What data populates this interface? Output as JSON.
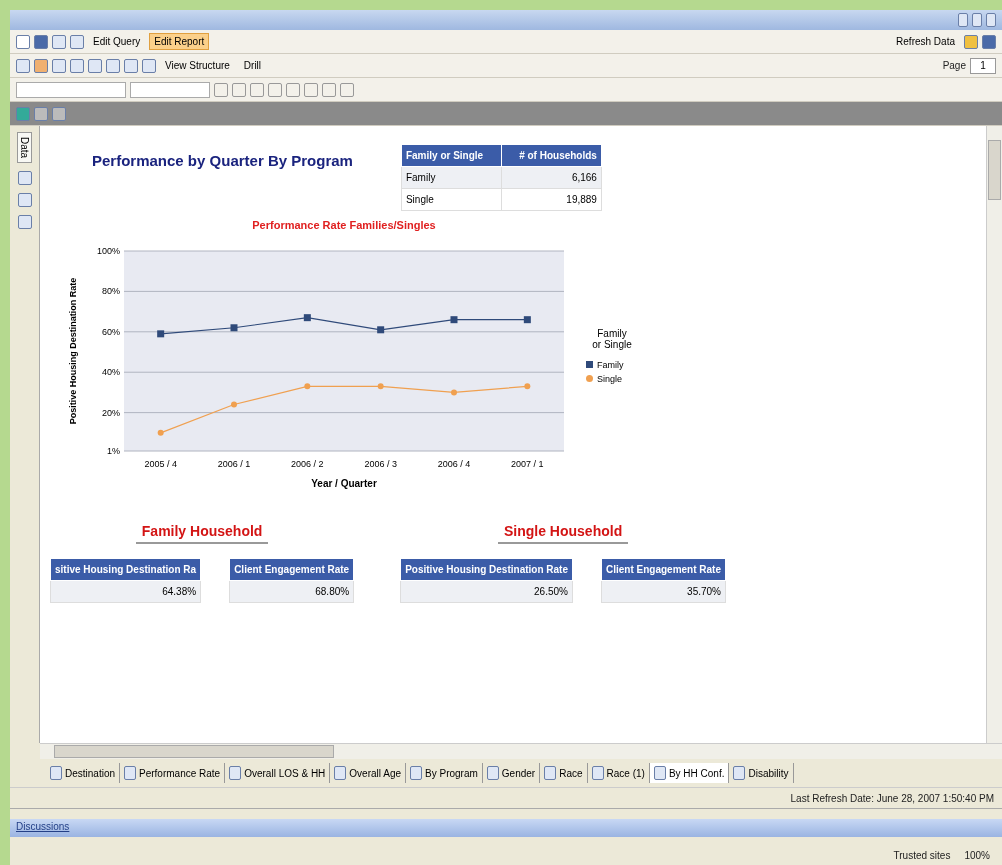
{
  "toolbar": {
    "edit_buttons": [
      {
        "label": "Edit Query",
        "selected": false
      },
      {
        "label": "Edit Report",
        "selected": true
      }
    ],
    "refresh": "Refresh Data"
  },
  "toolbar2": {
    "view_structure": "View Structure",
    "drill": "Drill",
    "page_label": "Page",
    "page_value": "1"
  },
  "side_tab": "Data",
  "report": {
    "title": "Performance by Quarter By Program",
    "summary_table": {
      "columns": [
        "Family or Single",
        "# of Households"
      ],
      "rows": [
        [
          "Family",
          "6,166"
        ],
        [
          "Single",
          "19,889"
        ]
      ]
    },
    "chart": {
      "chart_data": {
        "type": "line",
        "title": "Performance Rate Families/Singles",
        "xlabel": "Year / Quarter",
        "ylabel": "Positive Housing Destination Rate",
        "legend_title": "Family or Single",
        "categories": [
          "2005 / 4",
          "2006 / 1",
          "2006 / 2",
          "2006 / 3",
          "2006 / 4",
          "2007 / 1"
        ],
        "grid": true,
        "legend": "right",
        "series": [
          {
            "name": "Family",
            "color": "#2f4a7a",
            "marker": "square",
            "values": [
              59,
              62,
              67,
              61,
              66,
              66
            ]
          },
          {
            "name": "Single",
            "color": "#f0a050",
            "marker": "circle",
            "values": [
              10,
              24,
              33,
              33,
              30,
              33
            ]
          }
        ],
        "ylim": [
          1,
          100
        ],
        "yticks": [
          {
            "value": 1,
            "label": "1%"
          },
          {
            "value": 20,
            "label": "20%"
          },
          {
            "value": 40,
            "label": "40%"
          },
          {
            "value": 60,
            "label": "60%"
          },
          {
            "value": 80,
            "label": "80%"
          },
          {
            "value": 100,
            "label": "100%"
          }
        ]
      }
    },
    "sections": [
      {
        "heading": "Family Household",
        "tables": [
          {
            "header": "sitive Housing Destination Ra",
            "value": "64.38%"
          },
          {
            "header": "Client Engagement Rate",
            "value": "68.80%"
          }
        ]
      },
      {
        "heading": "Single Household",
        "tables": [
          {
            "header": "Positive Housing Destination Rate",
            "value": "26.50%"
          },
          {
            "header": "Client Engagement Rate",
            "value": "35.70%"
          }
        ]
      }
    ]
  },
  "sheet_tabs": [
    {
      "label": "Destination",
      "selected": false
    },
    {
      "label": "Performance Rate",
      "selected": false
    },
    {
      "label": "Overall LOS & HH",
      "selected": false
    },
    {
      "label": "Overall Age",
      "selected": false
    },
    {
      "label": "By Program",
      "selected": false
    },
    {
      "label": "Gender",
      "selected": false
    },
    {
      "label": "Race",
      "selected": false
    },
    {
      "label": "Race (1)",
      "selected": false
    },
    {
      "label": "By HH Conf.",
      "selected": true
    },
    {
      "label": "Disability",
      "selected": false
    }
  ],
  "status": "Last Refresh Date: June 28, 2007 1:50:40 PM",
  "discussions": "Discussions",
  "browser_status": {
    "zone": "Trusted sites",
    "zoom": "100%"
  }
}
